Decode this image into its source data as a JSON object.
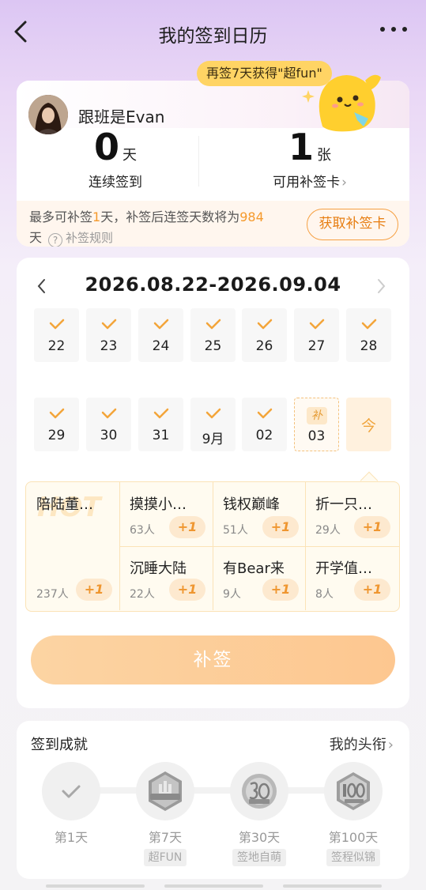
{
  "header": {
    "title": "我的签到日历",
    "back_icon": "back-arrow-icon",
    "more_icon": "more-dots-icon"
  },
  "promo": {
    "bubble_text": "再签7天获得\"超fun\""
  },
  "user": {
    "name": "跟班是Evan"
  },
  "stats": {
    "streak": {
      "value": "0",
      "unit": "天",
      "label": "连续签到"
    },
    "cards": {
      "value": "1",
      "unit": "张",
      "label": "可用补签卡"
    }
  },
  "notice": {
    "prefix": "最多可补签",
    "days": "1",
    "middle": "天，补签后连签天数将为",
    "total": "984",
    "suffix": "天",
    "rules_label": "补签规则",
    "get_card_button": "获取补签卡"
  },
  "calendar": {
    "range": "2026.08.22-2026.09.04",
    "row1": [
      "22",
      "23",
      "24",
      "25",
      "26",
      "27",
      "28"
    ],
    "row2": [
      "29",
      "30",
      "31",
      "9月",
      "02"
    ],
    "makeup_day": {
      "tag": "补",
      "date": "03"
    },
    "today": "今"
  },
  "help": {
    "hot_label": "HOT",
    "featured": {
      "name": "陪陆董…",
      "count": "237人",
      "plus": "+1"
    },
    "items": [
      {
        "name": "摸摸小…",
        "count": "63人",
        "plus": "+1"
      },
      {
        "name": "钱权巅峰",
        "count": "51人",
        "plus": "+1"
      },
      {
        "name": "折一只…",
        "count": "29人",
        "plus": "+1"
      },
      {
        "name": "沉睡大陆",
        "count": "22人",
        "plus": "+1"
      },
      {
        "name": "有Bear来",
        "count": "9人",
        "plus": "+1"
      },
      {
        "name": "开学值…",
        "count": "8人",
        "plus": "+1"
      }
    ],
    "makeup_button": "补签"
  },
  "achievements": {
    "title": "签到成就",
    "my_titles": "我的头衔",
    "badges": [
      {
        "day": "第1天",
        "name": "",
        "icon": "check-icon"
      },
      {
        "day": "第7天",
        "name": "超FUN",
        "icon": "fun-hand-badge-icon"
      },
      {
        "day": "第30天",
        "name": "签地自萌",
        "icon": "30-days-badge-icon"
      },
      {
        "day": "第100天",
        "name": "签程似锦",
        "icon": "100-days-badge-icon"
      }
    ]
  }
}
